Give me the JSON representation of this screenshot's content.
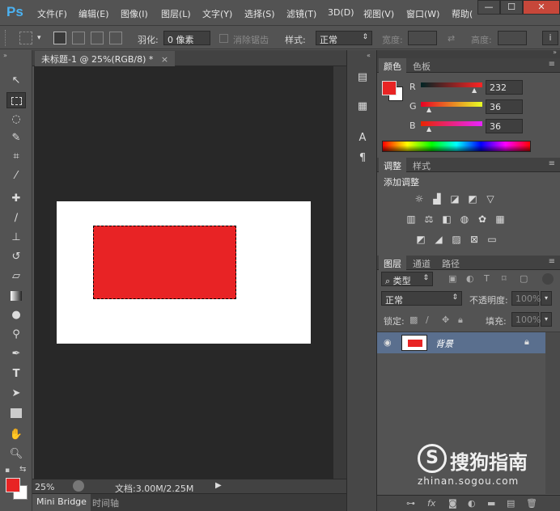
{
  "app": {
    "logo": "Ps"
  },
  "menu": [
    "文件(F)",
    "编辑(E)",
    "图像(I)",
    "图层(L)",
    "文字(Y)",
    "选择(S)",
    "滤镜(T)",
    "3D(D)",
    "视图(V)",
    "窗口(W)",
    "帮助("
  ],
  "window_controls": {
    "minimize": "—",
    "maximize": "☐",
    "close": "✕"
  },
  "options": {
    "feather_label": "羽化:",
    "feather_value": "0 像素",
    "antialias_label": "消除锯齿",
    "style_label": "样式:",
    "style_value": "正常",
    "width_label": "宽度:",
    "height_label": "高度:"
  },
  "document": {
    "tab_title": "未标题-1 @ 25%(RGB/8) *",
    "zoom": "25%",
    "doc_info": "文档:3.00M/2.25M"
  },
  "bottom_tabs": [
    "Mini Bridge",
    "时间轴"
  ],
  "color_panel": {
    "tabs": [
      "颜色",
      "色板"
    ],
    "r_label": "R",
    "g_label": "G",
    "b_label": "B",
    "r": "232",
    "g": "36",
    "b": "36",
    "foreground_color": "#e82424",
    "background_color": "#ffffff"
  },
  "adjustments_panel": {
    "tabs": [
      "调整",
      "样式"
    ],
    "title": "添加调整"
  },
  "layers_panel": {
    "tabs": [
      "图层",
      "通道",
      "路径"
    ],
    "filter_type": "类型",
    "blend_mode": "正常",
    "opacity_label": "不透明度:",
    "opacity_value": "100%",
    "lock_label": "锁定:",
    "fill_label": "填充:",
    "fill_value": "100%",
    "layers": [
      {
        "name": "背景",
        "visible": true,
        "locked": true
      }
    ]
  },
  "watermark": {
    "brand": "搜狗指南",
    "url": "zhinan.sogou.com"
  }
}
